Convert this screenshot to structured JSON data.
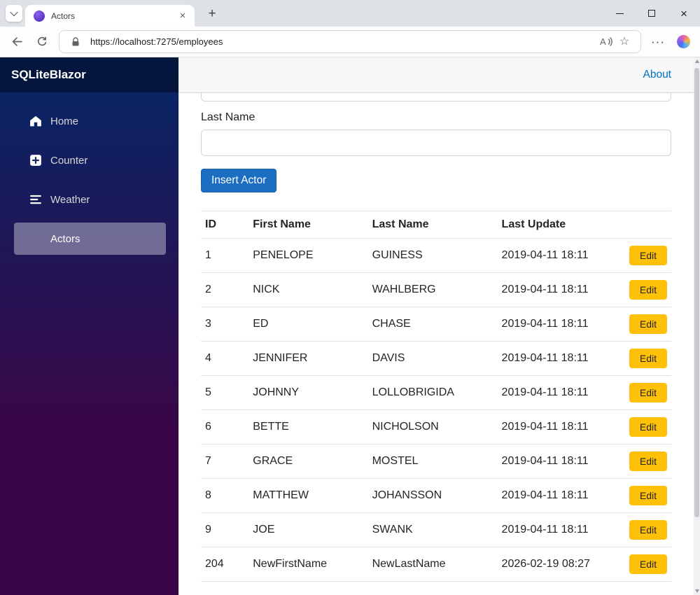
{
  "browser": {
    "tab_title": "Actors",
    "url": "https://localhost:7275/employees"
  },
  "app": {
    "brand": "SQLiteBlazor",
    "about_label": "About",
    "nav": [
      {
        "label": "Home",
        "icon": "home-icon",
        "active": false
      },
      {
        "label": "Counter",
        "icon": "plus-icon",
        "active": false
      },
      {
        "label": "Weather",
        "icon": "list-icon",
        "active": false
      },
      {
        "label": "Actors",
        "icon": "none",
        "active": true
      }
    ],
    "form": {
      "last_name_label": "Last Name",
      "last_name_value": "",
      "insert_button_label": "Insert Actor"
    },
    "table": {
      "headers": [
        "ID",
        "First Name",
        "Last Name",
        "Last Update"
      ],
      "edit_label": "Edit",
      "rows": [
        {
          "id": "1",
          "first_name": "PENELOPE",
          "last_name": "GUINESS",
          "last_update": "2019-04-11 18:11"
        },
        {
          "id": "2",
          "first_name": "NICK",
          "last_name": "WAHLBERG",
          "last_update": "2019-04-11 18:11"
        },
        {
          "id": "3",
          "first_name": "ED",
          "last_name": "CHASE",
          "last_update": "2019-04-11 18:11"
        },
        {
          "id": "4",
          "first_name": "JENNIFER",
          "last_name": "DAVIS",
          "last_update": "2019-04-11 18:11"
        },
        {
          "id": "5",
          "first_name": "JOHNNY",
          "last_name": "LOLLOBRIGIDA",
          "last_update": "2019-04-11 18:11"
        },
        {
          "id": "6",
          "first_name": "BETTE",
          "last_name": "NICHOLSON",
          "last_update": "2019-04-11 18:11"
        },
        {
          "id": "7",
          "first_name": "GRACE",
          "last_name": "MOSTEL",
          "last_update": "2019-04-11 18:11"
        },
        {
          "id": "8",
          "first_name": "MATTHEW",
          "last_name": "JOHANSSON",
          "last_update": "2019-04-11 18:11"
        },
        {
          "id": "9",
          "first_name": "JOE",
          "last_name": "SWANK",
          "last_update": "2019-04-11 18:11"
        },
        {
          "id": "204",
          "first_name": "NewFirstName",
          "last_name": "NewLastName",
          "last_update": "2026-02-19 08:27"
        }
      ]
    }
  },
  "colors": {
    "accent_blue": "#1b6ec2",
    "warning_yellow": "#ffc107",
    "link_blue": "#0071c1",
    "sidebar_gradient_start": "#052767",
    "sidebar_gradient_end": "#3a0647"
  }
}
